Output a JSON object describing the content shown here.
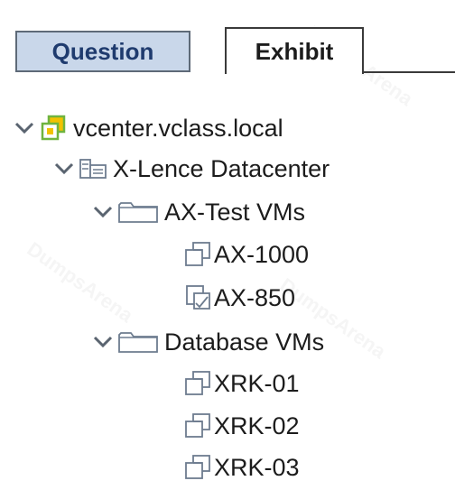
{
  "tabs": [
    {
      "label": "Question",
      "active": false
    },
    {
      "label": "Exhibit",
      "active": true
    }
  ],
  "tree": {
    "vcenter": {
      "label": "vcenter.vclass.local",
      "icon": "vcenter-icon"
    },
    "datacenter": {
      "label": "X-Lence Datacenter",
      "icon": "datacenter-icon"
    },
    "folders": [
      {
        "label": "AX-Test VMs",
        "icon": "folder-icon",
        "vms": [
          {
            "label": "AX-1000",
            "icon": "vm-icon"
          },
          {
            "label": "AX-850",
            "icon": "vm-template-icon"
          }
        ]
      },
      {
        "label": "Database VMs",
        "icon": "folder-icon",
        "vms": [
          {
            "label": "XRK-01",
            "icon": "vm-icon"
          },
          {
            "label": "XRK-02",
            "icon": "vm-icon"
          },
          {
            "label": "XRK-03",
            "icon": "vm-icon"
          }
        ]
      }
    ]
  },
  "watermark": {
    "text": "DumpsArena"
  },
  "colors": {
    "question_tab_bg": "#c9d7ea",
    "question_tab_text": "#1f3b6e",
    "vcenter_green": "#6fb43f",
    "vcenter_yellow": "#f2c200",
    "icon_gray": "#6d7c8f"
  }
}
